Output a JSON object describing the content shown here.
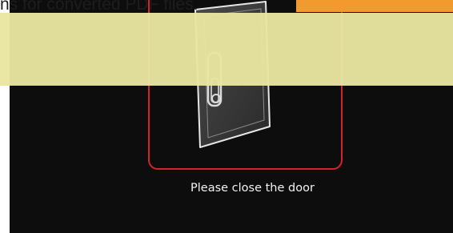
{
  "caption": {
    "text": "ns for converted PDF files."
  },
  "screen": {
    "status_text": "Please close the door"
  },
  "colors": {
    "highlight": "#e9e6a0",
    "accent_button": "#f29a2e",
    "door_frame": "#d4232b",
    "screen_background": "#0d0d0d"
  }
}
